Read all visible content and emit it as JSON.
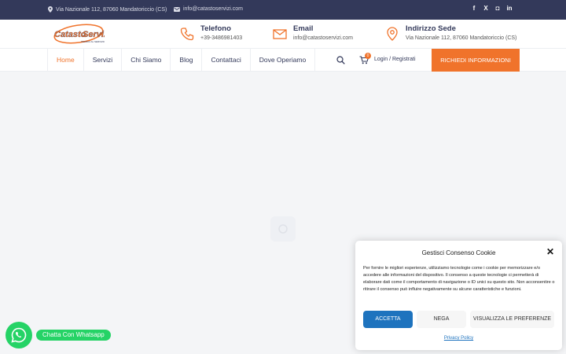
{
  "topbar": {
    "address": "Via Nazionale 112, 87060 Mandatoriccio (CS)",
    "email": "info@catastoservizi.com",
    "social": [
      "f",
      "X",
      "◘",
      "in"
    ]
  },
  "header": {
    "logo_text_1": "Catasto",
    "logo_text_2": "Servizi",
    "logo_tagline": "TECNICI AL SERVIZIO",
    "phone_title": "Telefono",
    "phone_value": "+39-3486981403",
    "email_title": "Email",
    "email_value": "info@catastoservizi.com",
    "address_title": "Indirizzo Sede",
    "address_value": "Via Nazionale 112, 87060 Mandatoriccio (CS)"
  },
  "nav": {
    "items": [
      "Home",
      "Servizi",
      "Chi Siamo",
      "Blog",
      "Contattaci",
      "Dove Operiamo"
    ],
    "cart_count": "0",
    "login": " Login / Registrati",
    "cta": "RICHIEDI INFORMAZIONI"
  },
  "whatsapp": {
    "label": "Chatta Con Whatsapp"
  },
  "cookie": {
    "title": "Gestisci Consenso Cookie",
    "text": "Per fornire le migliori esperienze, utilizziamo tecnologie come i cookie per memorizzare e/o accedere alle informazioni del dispositivo. Il consenso a queste tecnologie ci permetterà di elaborare dati come il comportamento di navigazione o ID unici su questo sito. Non acconsentire o ritirare il consenso può influire negativamente su alcune caratteristiche e funzioni.",
    "accept": "ACCETTA",
    "deny": "NEGA",
    "preferences": "VISUALIZZA LE PREFERENZE",
    "policy": "Privacy Policy"
  },
  "colors": {
    "accent": "#f0732b",
    "navy": "#33395a",
    "whatsapp": "#25d366",
    "primary_button": "#1e73be"
  }
}
